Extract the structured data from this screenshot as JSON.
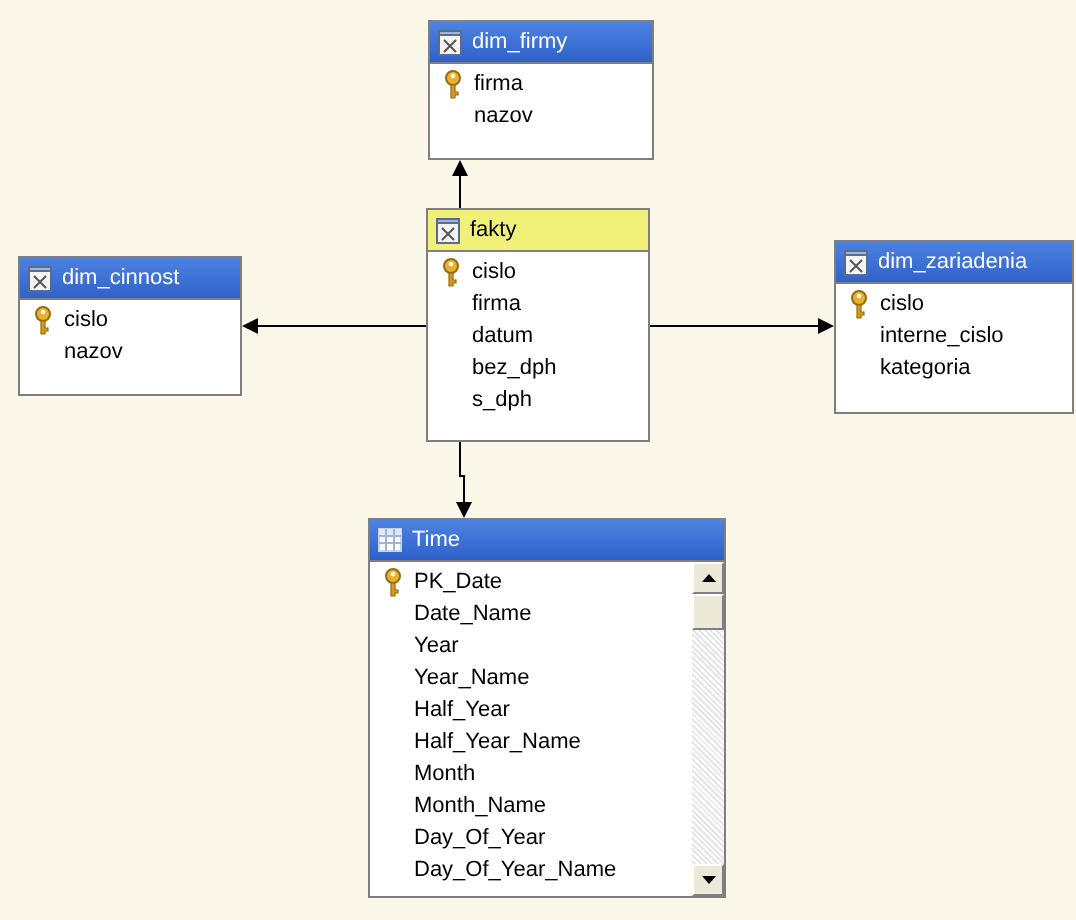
{
  "tables": [
    {
      "name": "dim_firmy",
      "kind": "query",
      "selected": false,
      "columns": [
        {
          "name": "firma",
          "key": true
        },
        {
          "name": "nazov",
          "key": false
        }
      ]
    },
    {
      "name": "dim_cinnost",
      "kind": "query",
      "selected": false,
      "columns": [
        {
          "name": "cislo",
          "key": true
        },
        {
          "name": "nazov",
          "key": false
        }
      ]
    },
    {
      "name": "fakty",
      "kind": "query",
      "selected": true,
      "columns": [
        {
          "name": "cislo",
          "key": true
        },
        {
          "name": "firma",
          "key": false
        },
        {
          "name": "datum",
          "key": false
        },
        {
          "name": "bez_dph",
          "key": false
        },
        {
          "name": "s_dph",
          "key": false
        }
      ]
    },
    {
      "name": "dim_zariadenia",
      "kind": "query",
      "selected": false,
      "columns": [
        {
          "name": "cislo",
          "key": true
        },
        {
          "name": "interne_cislo",
          "key": false
        },
        {
          "name": "kategoria",
          "key": false
        }
      ]
    },
    {
      "name": "Time",
      "kind": "table",
      "selected": false,
      "columns": [
        {
          "name": "PK_Date",
          "key": true
        },
        {
          "name": "Date_Name",
          "key": false
        },
        {
          "name": "Year",
          "key": false
        },
        {
          "name": "Year_Name",
          "key": false
        },
        {
          "name": "Half_Year",
          "key": false
        },
        {
          "name": "Half_Year_Name",
          "key": false
        },
        {
          "name": "Month",
          "key": false
        },
        {
          "name": "Month_Name",
          "key": false
        },
        {
          "name": "Day_Of_Year",
          "key": false
        },
        {
          "name": "Day_Of_Year_Name",
          "key": false
        }
      ]
    }
  ]
}
